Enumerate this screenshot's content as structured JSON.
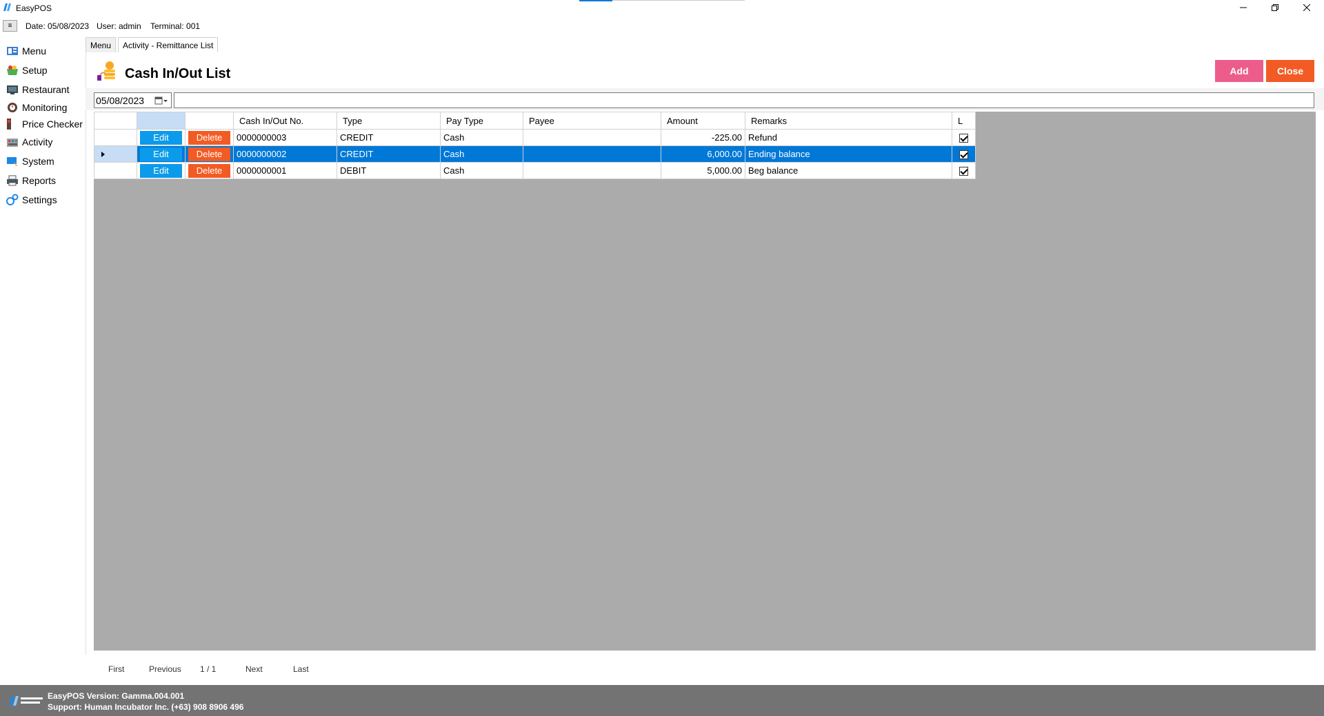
{
  "window": {
    "title": "EasyPOS"
  },
  "infobar": {
    "menu_toggle": "≡",
    "date": "Date: 05/08/2023",
    "user": "User: admin",
    "terminal": "Terminal: 001"
  },
  "sidebar": {
    "items": [
      {
        "label": "Menu",
        "icon": "menu-icon"
      },
      {
        "label": "Setup",
        "icon": "setup-icon"
      },
      {
        "label": "Restaurant",
        "icon": "restaurant-icon"
      },
      {
        "label": "Monitoring",
        "icon": "monitoring-icon"
      },
      {
        "label": "Price Checker",
        "icon": "price-checker-icon"
      },
      {
        "label": "Activity",
        "icon": "activity-icon"
      },
      {
        "label": "System",
        "icon": "system-icon"
      },
      {
        "label": "Reports",
        "icon": "reports-icon"
      },
      {
        "label": "Settings",
        "icon": "settings-icon"
      }
    ]
  },
  "tabs": [
    {
      "label": "Menu",
      "active": false
    },
    {
      "label": "Activity - Remittance List",
      "active": true
    }
  ],
  "page": {
    "title": "Cash In/Out List",
    "add_label": "Add",
    "close_label": "Close"
  },
  "filter": {
    "date_value": "05/08/2023",
    "search_value": ""
  },
  "grid": {
    "columns": [
      "",
      "",
      "",
      "Cash In/Out No.",
      "Type",
      "Pay Type",
      "Payee",
      "Amount",
      "Remarks",
      "L"
    ],
    "edit_label": "Edit",
    "delete_label": "Delete",
    "rows": [
      {
        "no": "0000000003",
        "type": "CREDIT",
        "pay_type": "Cash",
        "payee": "",
        "amount": "-225.00",
        "remarks": "Refund",
        "locked": true,
        "selected": false
      },
      {
        "no": "0000000002",
        "type": "CREDIT",
        "pay_type": "Cash",
        "payee": "",
        "amount": "6,000.00",
        "remarks": "Ending balance",
        "locked": true,
        "selected": true
      },
      {
        "no": "0000000001",
        "type": "DEBIT",
        "pay_type": "Cash",
        "payee": "",
        "amount": "5,000.00",
        "remarks": "Beg balance",
        "locked": true,
        "selected": false
      }
    ]
  },
  "pager": {
    "first": "First",
    "previous": "Previous",
    "page_info": "1 / 1",
    "next": "Next",
    "last": "Last"
  },
  "footer": {
    "version": "EasyPOS Version: Gamma.004.001",
    "support": "Support: Human Incubator Inc. (+63) 908 8906 496"
  },
  "colors": {
    "add_button": "#ec5d8c",
    "close_button": "#f35b24",
    "edit_button": "#0c9bea",
    "delete_button": "#f35b24",
    "selected_row": "#0078d7",
    "footer": "#737373",
    "grid_background": "#ababab"
  }
}
